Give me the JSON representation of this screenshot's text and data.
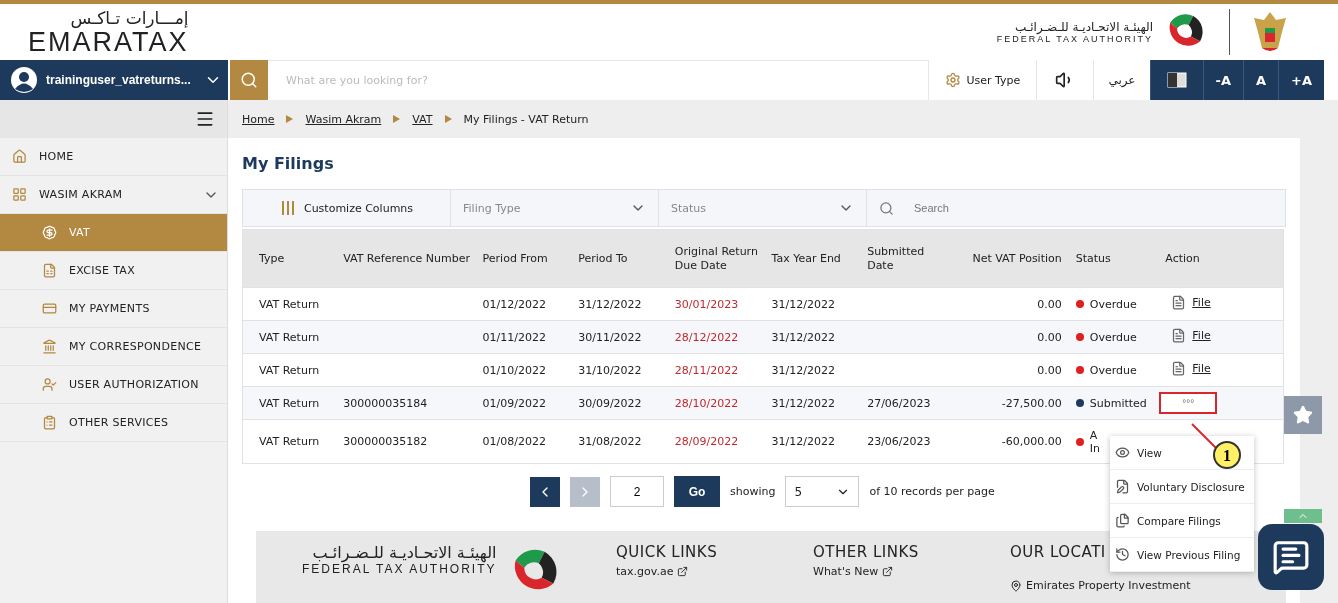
{
  "header": {
    "logo_arabic": "إمـــارات تـاكـس",
    "logo_text": "EMARATAX",
    "fta_arabic": "الهيئـة الاتحـاديـة للـضـرائـب",
    "fta_english": "FEDERAL TAX AUTHORITY"
  },
  "user": {
    "name": "traininguser_vatreturns..."
  },
  "topbar": {
    "search_placeholder": "What are you looking for?",
    "user_type": "User Type",
    "language": "عربي",
    "font_buttons": [
      "-A",
      "A",
      "+A"
    ]
  },
  "breadcrumb": [
    {
      "label": "Home",
      "link": true
    },
    {
      "label": "Wasim Akram",
      "link": true
    },
    {
      "label": "VAT",
      "link": true
    },
    {
      "label": "My Filings - VAT Return",
      "link": false
    }
  ],
  "sidebar": {
    "items": [
      {
        "label": "HOME",
        "selected": false
      },
      {
        "label": "WASIM AKRAM",
        "selected": false,
        "expanded": true,
        "children": [
          {
            "label": "VAT",
            "selected": true
          },
          {
            "label": "EXCISE TAX",
            "selected": false
          },
          {
            "label": "MY PAYMENTS",
            "selected": false
          },
          {
            "label": "MY CORRESPONDENCE",
            "selected": false
          },
          {
            "label": "USER AUTHORIZATION",
            "selected": false
          },
          {
            "label": "OTHER SERVICES",
            "selected": false
          }
        ]
      }
    ]
  },
  "page_title": "My Filings",
  "filters": {
    "customize": "Customize Columns",
    "filing_type": "Filing Type",
    "status": "Status",
    "search_placeholder": "Search"
  },
  "table": {
    "columns": [
      "Type",
      "VAT Reference Number",
      "Period From",
      "Period To",
      "Original Return Due Date",
      "Tax Year End",
      "Submitted Date",
      "Net VAT Position",
      "Status",
      "Action"
    ],
    "rows": [
      {
        "type": "VAT Return",
        "ref": "",
        "from": "01/12/2022",
        "to": "31/12/2022",
        "due": "30/01/2023",
        "tax_year_end": "31/12/2022",
        "submitted": "",
        "net": "0.00",
        "status": {
          "label": "Overdue",
          "color": "#e02020"
        },
        "action": {
          "kind": "file",
          "label": "File"
        }
      },
      {
        "type": "VAT Return",
        "ref": "",
        "from": "01/11/2022",
        "to": "30/11/2022",
        "due": "28/12/2022",
        "tax_year_end": "31/12/2022",
        "submitted": "",
        "net": "0.00",
        "status": {
          "label": "Overdue",
          "color": "#e02020"
        },
        "action": {
          "kind": "file",
          "label": "File"
        }
      },
      {
        "type": "VAT Return",
        "ref": "",
        "from": "01/10/2022",
        "to": "31/10/2022",
        "due": "28/11/2022",
        "tax_year_end": "31/12/2022",
        "submitted": "",
        "net": "0.00",
        "status": {
          "label": "Overdue",
          "color": "#e02020"
        },
        "action": {
          "kind": "file",
          "label": "File"
        }
      },
      {
        "type": "VAT Return",
        "ref": "300000035184",
        "from": "01/09/2022",
        "to": "30/09/2022",
        "due": "28/10/2022",
        "tax_year_end": "31/12/2022",
        "submitted": "27/06/2023",
        "net": "-27,500.00",
        "status": {
          "label": "Submitted",
          "color": "#1d3a5c"
        },
        "action": {
          "kind": "menu",
          "label": "°°°"
        }
      },
      {
        "type": "VAT Return",
        "ref": "300000035182",
        "from": "01/08/2022",
        "to": "31/08/2022",
        "due": "28/09/2022",
        "tax_year_end": "31/12/2022",
        "submitted": "23/06/2023",
        "net": "-60,000.00",
        "status": {
          "label": "A\nIn",
          "color": "#e02020"
        }
      }
    ]
  },
  "pagination": {
    "page": "2",
    "showing": "showing",
    "per_page": "5",
    "suffix": "of 10 records per page",
    "go": "Go"
  },
  "action_menu": [
    "View",
    "Voluntary Disclosure",
    "Compare Filings",
    "View Previous Filing"
  ],
  "callout": "1",
  "footer": {
    "fta_arabic": "الهيئـة الاتحـاديـة للـضـرائـب",
    "fta_english": "FEDERAL TAX AUTHORITY",
    "columns": [
      {
        "title": "QUICK LINKS",
        "link": "tax.gov.ae"
      },
      {
        "title": "OTHER LINKS",
        "link": "What's New"
      },
      {
        "title": "OUR LOCATI",
        "link": "Emirates Property Investment"
      }
    ]
  }
}
